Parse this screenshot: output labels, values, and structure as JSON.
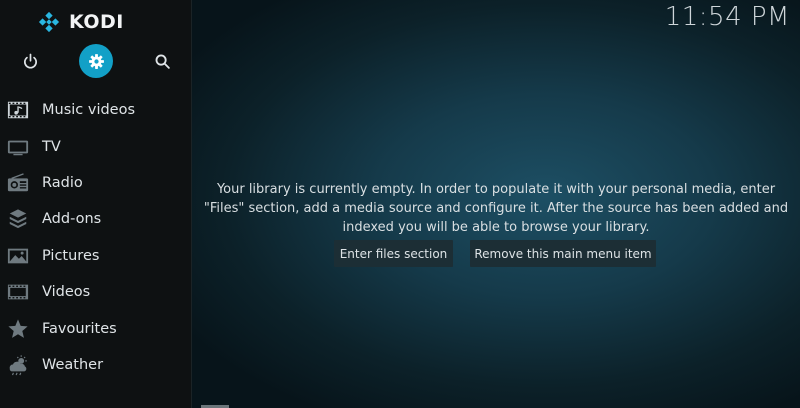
{
  "app": {
    "logo_text": "KODI",
    "accent_color": "#12a0c7"
  },
  "top_buttons": [
    {
      "icon": "power-icon"
    },
    {
      "icon": "gear-icon",
      "selected": true
    },
    {
      "icon": "search-icon"
    }
  ],
  "menu": {
    "items": [
      {
        "label": "Music videos",
        "icon": "music-video-icon"
      },
      {
        "label": "TV",
        "icon": "tv-icon"
      },
      {
        "label": "Radio",
        "icon": "radio-icon"
      },
      {
        "label": "Add-ons",
        "icon": "addons-icon"
      },
      {
        "label": "Pictures",
        "icon": "pictures-icon"
      },
      {
        "label": "Videos",
        "icon": "film-icon"
      },
      {
        "label": "Favourites",
        "icon": "star-icon"
      },
      {
        "label": "Weather",
        "icon": "weather-icon"
      }
    ]
  },
  "header": {
    "clock": "11:54 PM"
  },
  "main": {
    "message_lines": [
      "Your library is currently empty. In order to populate it with your personal media, enter",
      "\"Files\" section, add a media source and configure it. After the source has been added and",
      "indexed you will be able to browse your library."
    ],
    "enter_files_label": "Enter files section",
    "remove_item_label": "Remove this main menu item"
  }
}
